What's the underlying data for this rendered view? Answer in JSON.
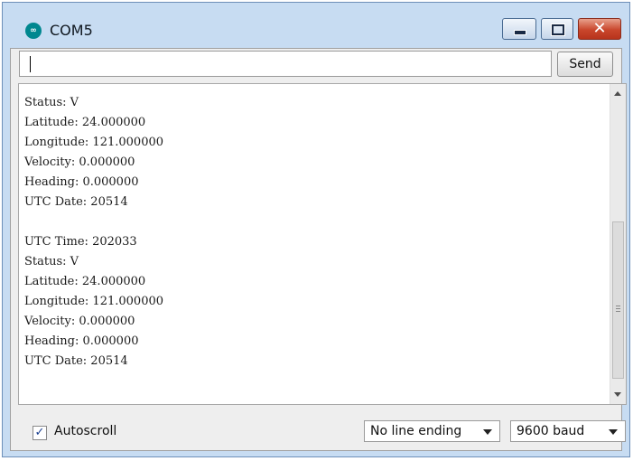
{
  "window": {
    "title": "COM5",
    "icon": "arduino-icon",
    "controls": {
      "minimize_icon": "minimize-icon",
      "maximize_icon": "maximize-icon",
      "close_icon": "close-icon",
      "close_glyph": "✕"
    },
    "colors": {
      "frame": "#c7dcf2",
      "close_button": "#c9462c",
      "output_bg": "#ffffff"
    }
  },
  "send": {
    "input_value": "",
    "input_placeholder": "",
    "button_label": "Send"
  },
  "output": {
    "text": "Status: V\nLatitude: 24.000000\nLongitude: 121.000000\nVelocity: 0.000000\nHeading: 0.000000\nUTC Date: 20514\n\nUTC Time: 202033\nStatus: V\nLatitude: 24.000000\nLongitude: 121.000000\nVelocity: 0.000000\nHeading: 0.000000\nUTC Date: 20514",
    "scrollbar": {
      "thumb_start_fraction": 0.42,
      "thumb_size_fraction": 0.55
    }
  },
  "footer": {
    "autoscroll_label": "Autoscroll",
    "autoscroll_checked": true,
    "checkmark": "✓",
    "line_ending_selected": "No line ending",
    "baud_selected": "9600 baud"
  }
}
